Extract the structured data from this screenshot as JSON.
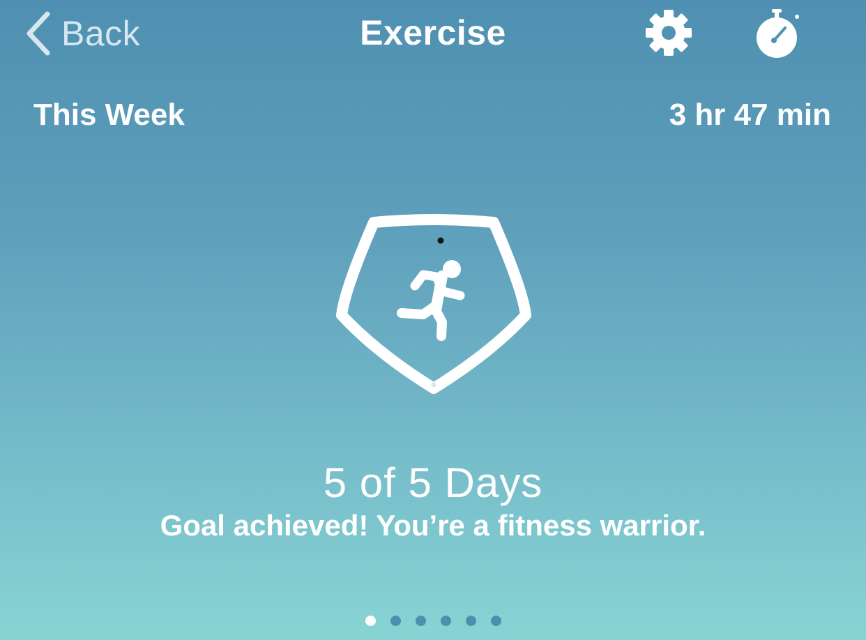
{
  "nav": {
    "back_label": "Back",
    "title": "Exercise",
    "settings_icon": "gear-icon",
    "stopwatch_icon": "stopwatch-icon"
  },
  "summary": {
    "period_label": "This Week",
    "total_duration": "3 hr 47 min"
  },
  "badge": {
    "icon": "running-person-icon"
  },
  "goal": {
    "days_text": "5 of 5 Days",
    "days_completed": 5,
    "days_target": 5,
    "message": "Goal achieved! You’re a fitness warrior."
  },
  "pagination": {
    "page_count": 6,
    "current_page": 1
  },
  "colors": {
    "gradient_top": "#4f90b2",
    "gradient_bottom": "#88d4d4",
    "text": "#ffffff",
    "back_text": "#d6e7f0",
    "dot_inactive": "#4c8fae"
  }
}
